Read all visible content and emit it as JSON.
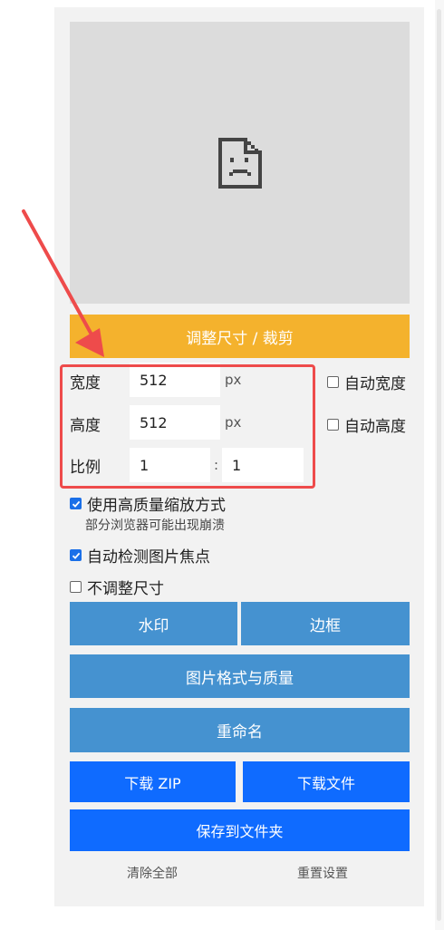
{
  "crop_button": "调整尺寸 / 裁剪",
  "dimensions": {
    "width": {
      "label": "宽度",
      "value": "512",
      "unit": "px",
      "auto_label": "自动宽度",
      "auto_checked": false
    },
    "height": {
      "label": "高度",
      "value": "512",
      "unit": "px",
      "auto_label": "自动高度",
      "auto_checked": false
    },
    "ratio": {
      "label": "比例",
      "left": "1",
      "separator": ":",
      "right": "1"
    }
  },
  "options": {
    "high_quality": {
      "label": "使用高质量缩放方式",
      "note": "部分浏览器可能出现崩溃",
      "checked": true
    },
    "auto_focus": {
      "label": "自动检测图片焦点",
      "checked": true
    },
    "no_resize": {
      "label": "不调整尺寸",
      "checked": false
    }
  },
  "buttons": {
    "watermark": "水印",
    "border": "边框",
    "format_quality": "图片格式与质量",
    "rename": "重命名",
    "download_zip": "下载 ZIP",
    "download_files": "下载文件",
    "save_folder": "保存到文件夹"
  },
  "links": {
    "clear_all": "清除全部",
    "reset_settings": "重置设置"
  },
  "icons": {
    "preview": "broken-image-icon",
    "annotation": "red-arrow-icon"
  },
  "colors": {
    "crop": "#f4b22d",
    "steel": "#4592d0",
    "download": "#0f6bff",
    "highlight": "#ee4b4b",
    "checkbox": "#1a6fe8"
  }
}
